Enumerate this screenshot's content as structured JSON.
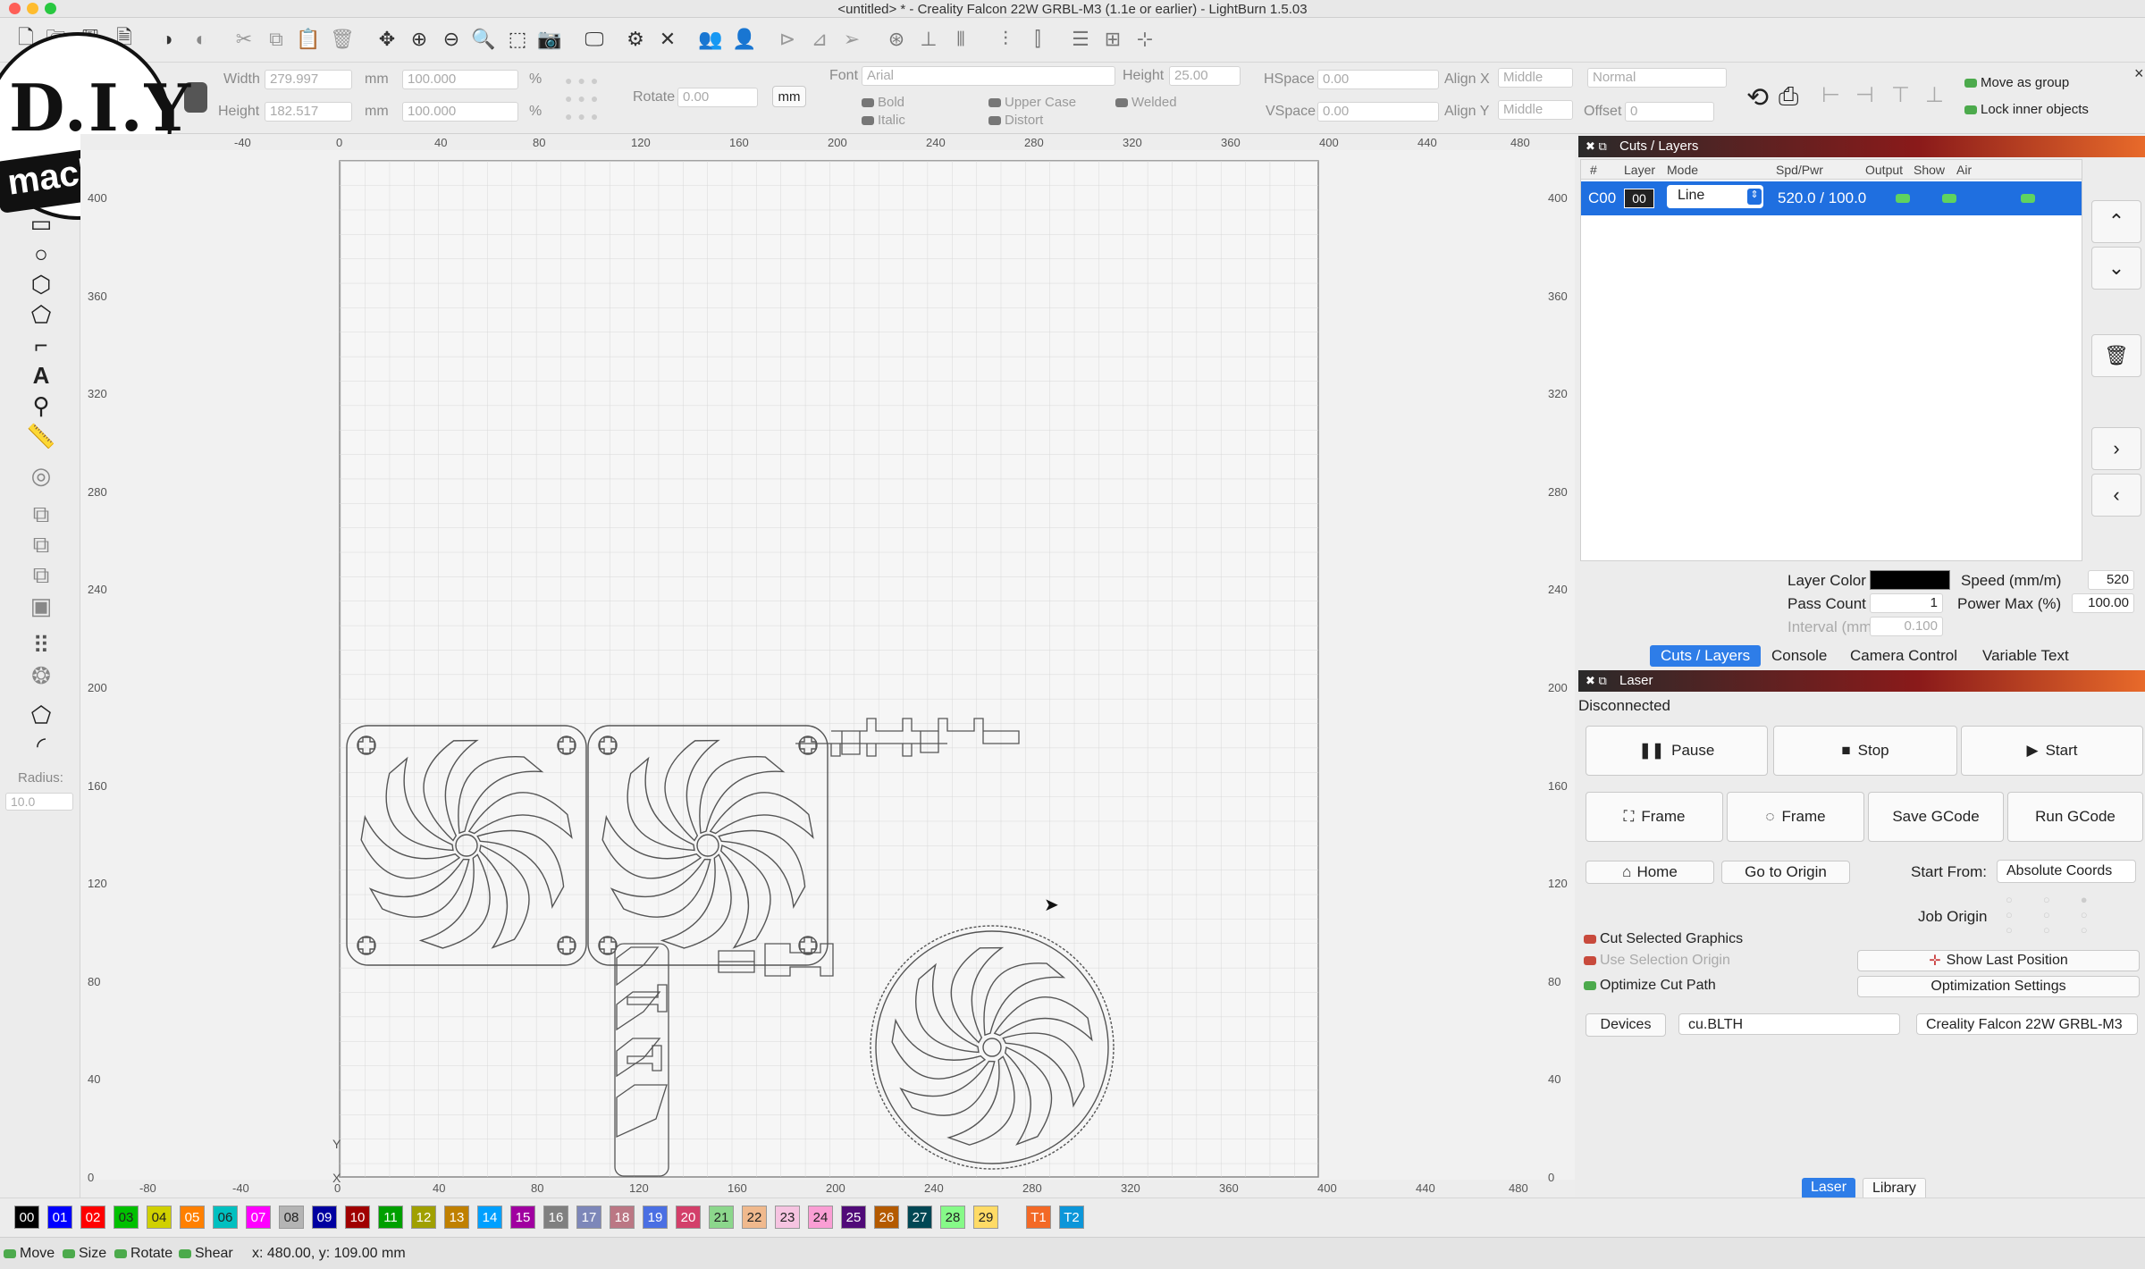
{
  "window": {
    "title": "<untitled> * - Creality Falcon 22W GRBL-M3 (1.1e or earlier) - LightBurn 1.5.03"
  },
  "logo": {
    "line1": "D.I.Y",
    "line2": "machines"
  },
  "props": {
    "width_label": "Width",
    "width_value": "279.997",
    "height_label": "Height",
    "height_value": "182.517",
    "unit": "mm",
    "scale_w": "100.000",
    "scale_h": "100.000",
    "pct": "%",
    "rotate_label": "Rotate",
    "rotate_value": "0.00",
    "mm_button": "mm",
    "font_label": "Font",
    "font_value": "Arial",
    "text_height_label": "Height",
    "text_height_value": "25.00",
    "hspace_label": "HSpace",
    "hspace_value": "0.00",
    "vspace_label": "VSpace",
    "vspace_value": "0.00",
    "alignx_label": "Align X",
    "alignx_value": "Middle",
    "aligny_label": "Align Y",
    "aligny_value": "Middle",
    "normal_value": "Normal",
    "offset_label": "Offset",
    "offset_value": "0",
    "bold": "Bold",
    "italic": "Italic",
    "upper_case": "Upper Case",
    "distort": "Distort",
    "welded": "Welded",
    "move_as_group": "Move as group",
    "lock_inner": "Lock inner objects"
  },
  "left_tools": {
    "radius_label": "Radius:",
    "radius_value": "10.0"
  },
  "ruler": {
    "top": [
      "-40",
      "0",
      "40",
      "80",
      "120",
      "160",
      "200",
      "240",
      "280",
      "320",
      "360",
      "400",
      "440",
      "480"
    ],
    "bottom": [
      "-80",
      "-40",
      "0",
      "40",
      "80",
      "120",
      "160",
      "200",
      "240",
      "280",
      "320",
      "360",
      "400",
      "440",
      "480"
    ],
    "left": [
      "400",
      "360",
      "320",
      "280",
      "240",
      "200",
      "160",
      "120",
      "80",
      "40",
      "0"
    ],
    "right": [
      "400",
      "360",
      "320",
      "280",
      "240",
      "200",
      "160",
      "120",
      "80",
      "40",
      "0"
    ],
    "axis_y": "Y",
    "axis_x": "X"
  },
  "cuts": {
    "panel_title": "Cuts / Layers",
    "columns": [
      "#",
      "Layer",
      "Mode",
      "Spd/Pwr",
      "Output",
      "Show",
      "Air"
    ],
    "row": {
      "id": "C00",
      "layer": "00",
      "mode": "Line",
      "spdpwr": "520.0 / 100.0"
    },
    "layer_color_label": "Layer Color",
    "layer_color": "#000000",
    "speed_label": "Speed (mm/m)",
    "speed_value": "520",
    "pass_label": "Pass Count",
    "pass_value": "1",
    "power_label": "Power Max (%)",
    "power_value": "100.00",
    "interval_label": "Interval (mm)",
    "interval_value": "0.100",
    "tabs": [
      "Cuts / Layers",
      "Console",
      "Camera Control",
      "Variable Text"
    ]
  },
  "laser": {
    "panel_title": "Laser",
    "status": "Disconnected",
    "pause": "Pause",
    "stop": "Stop",
    "start": "Start",
    "frame1": "Frame",
    "frame2": "Frame",
    "save_gcode": "Save GCode",
    "run_gcode": "Run GCode",
    "home": "Home",
    "go_to_origin": "Go to Origin",
    "start_from_label": "Start From:",
    "start_from_value": "Absolute Coords",
    "job_origin_label": "Job Origin",
    "cut_selected": "Cut Selected Graphics",
    "use_selection_origin": "Use Selection Origin",
    "optimize_cut_path": "Optimize Cut Path",
    "show_last_position": "Show Last Position",
    "optimization_settings": "Optimization Settings",
    "devices": "Devices",
    "port": "cu.BLTH",
    "device": "Creality Falcon 22W GRBL-M3",
    "bottom_tabs": [
      "Laser",
      "Library"
    ]
  },
  "palette": [
    {
      "label": "00",
      "color": "#000000"
    },
    {
      "label": "01",
      "color": "#0000ff"
    },
    {
      "label": "02",
      "color": "#ff0000"
    },
    {
      "label": "03",
      "color": "#00c000"
    },
    {
      "label": "04",
      "color": "#d0d000"
    },
    {
      "label": "05",
      "color": "#ff8000"
    },
    {
      "label": "06",
      "color": "#00c0c0"
    },
    {
      "label": "07",
      "color": "#ff00ff"
    },
    {
      "label": "08",
      "color": "#b4b4b4"
    },
    {
      "label": "09",
      "color": "#0000a0"
    },
    {
      "label": "10",
      "color": "#a00000"
    },
    {
      "label": "11",
      "color": "#00a000"
    },
    {
      "label": "12",
      "color": "#a0a000"
    },
    {
      "label": "13",
      "color": "#c08000"
    },
    {
      "label": "14",
      "color": "#00a0ff"
    },
    {
      "label": "15",
      "color": "#a000a0"
    },
    {
      "label": "16",
      "color": "#808080"
    },
    {
      "label": "17",
      "color": "#7d87b9"
    },
    {
      "label": "18",
      "color": "#bb7784"
    },
    {
      "label": "19",
      "color": "#4a6fe3"
    },
    {
      "label": "20",
      "color": "#d33f6a"
    },
    {
      "label": "21",
      "color": "#8cd78c"
    },
    {
      "label": "22",
      "color": "#f0b98d"
    },
    {
      "label": "23",
      "color": "#f6c4e1"
    },
    {
      "label": "24",
      "color": "#fa9ed4"
    },
    {
      "label": "25",
      "color": "#500a78"
    },
    {
      "label": "26",
      "color": "#b45a00"
    },
    {
      "label": "27",
      "color": "#004754"
    },
    {
      "label": "28",
      "color": "#86fa88"
    },
    {
      "label": "29",
      "color": "#ffdb66"
    },
    {
      "label": "T1",
      "color": "#f36926"
    },
    {
      "label": "T2",
      "color": "#0c96d9"
    }
  ],
  "status": {
    "move": "Move",
    "size": "Size",
    "rotate": "Rotate",
    "shear": "Shear",
    "coords": "x: 480.00, y: 109.00 mm"
  }
}
